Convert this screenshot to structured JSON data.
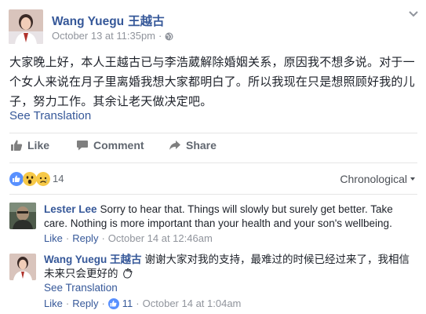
{
  "post": {
    "author_name": "Wang Yuegu",
    "author_name_cn": "王越古",
    "timestamp": "October 13 at 11:35pm",
    "privacy_icon": "globe-icon",
    "body_line1": "大家晚上好，本人王越古已与李浩葳解除婚姻关系，原因我不想多说。对于一",
    "body_line2": "个女人来说在月子里离婚我想大家都明白了。所以我现在只是想照顾好我的儿",
    "body_line3": "子，努力工作。其余让老天做决定吧。",
    "see_translation": "See Translation"
  },
  "actions": {
    "like_label": "Like",
    "comment_label": "Comment",
    "share_label": "Share"
  },
  "reactions": {
    "icons": [
      "like-reaction-icon",
      "wow-reaction-icon",
      "sad-reaction-icon"
    ],
    "count": "14",
    "sort_label": "Chronological"
  },
  "comments": [
    {
      "author": "Lester Lee",
      "text_line1": "Sorry to hear that. Things will slowly but surely get better. Take",
      "text_line2": "care. Nothing is more important than your health and your son's wellbeing.",
      "like": "Like",
      "reply": "Reply",
      "time": "October 14 at 12:46am"
    },
    {
      "author": "Wang Yuegu",
      "author_cn": "王越古",
      "text_line1": "谢谢大家对我的支持，最难过的时候已经过来了，我相信",
      "text_line2": "未来只会更好的",
      "see_translation": "See Translation",
      "like": "Like",
      "reply": "Reply",
      "likes_count": "11",
      "time": "October 14 at 1:04am"
    }
  ],
  "colors": {
    "link_blue": "#365899",
    "meta_grey": "#90949c",
    "action_grey": "#616770",
    "like_blue": "#5890ff",
    "reaction_yellow": "#f7c948"
  }
}
